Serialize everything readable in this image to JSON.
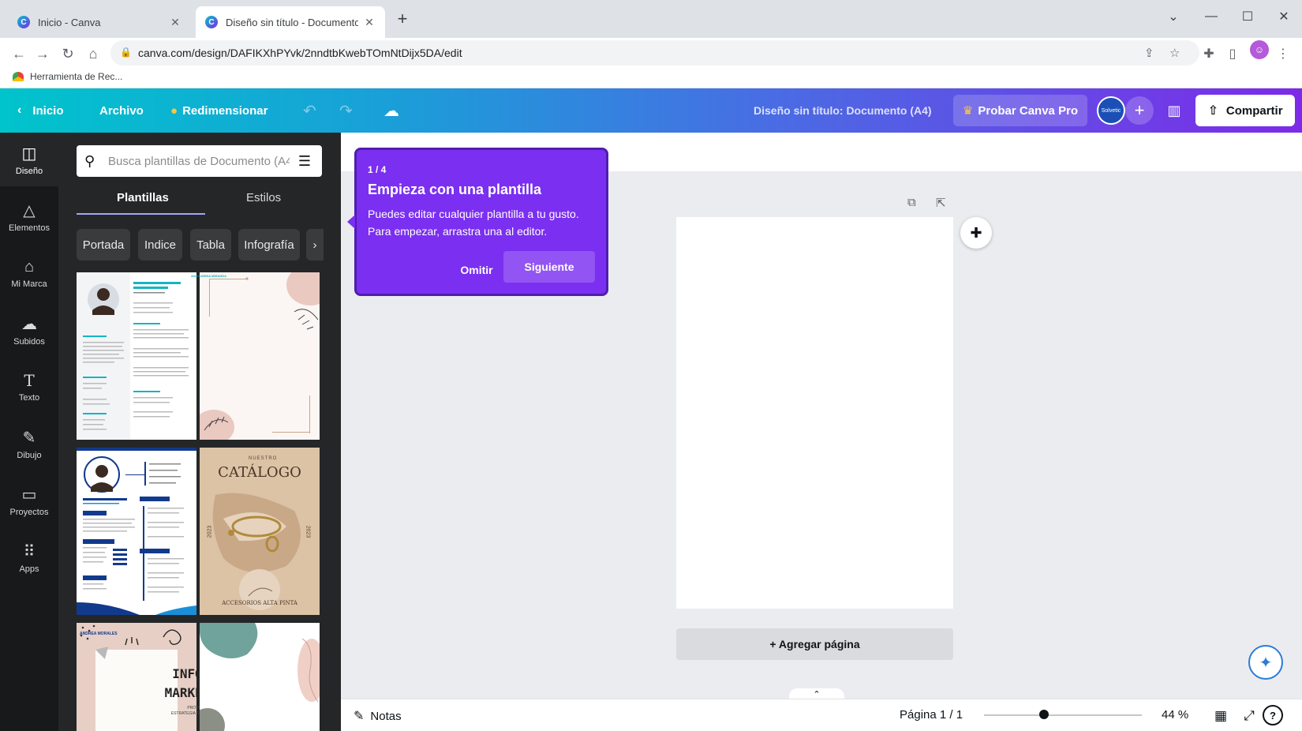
{
  "browser": {
    "tabs": [
      {
        "title": "Inicio - Canva"
      },
      {
        "title": "Diseño sin título - Documento (A"
      }
    ],
    "url": "canva.com/design/DAFIKXhPYvk/2nndtbKwebTOmNtDijx5DA/edit",
    "bookmark": "Herramienta de Rec..."
  },
  "header": {
    "home": "Inicio",
    "file": "Archivo",
    "resize": "Redimensionar",
    "doc_title": "Diseño sin título: Documento (A4)",
    "try_pro": "Probar Canva Pro",
    "share": "Compartir",
    "team_label": "Solvetic"
  },
  "rail": {
    "items": [
      {
        "label": "Diseño"
      },
      {
        "label": "Elementos"
      },
      {
        "label": "Mi Marca"
      },
      {
        "label": "Subidos"
      },
      {
        "label": "Texto"
      },
      {
        "label": "Dibujo"
      },
      {
        "label": "Proyectos"
      },
      {
        "label": "Apps"
      }
    ]
  },
  "panel": {
    "search_placeholder": "Busca plantillas de Documento (A4",
    "tabs": [
      "Plantillas",
      "Estilos"
    ],
    "chips": [
      "Portada",
      "Indice",
      "Tabla",
      "Infografía"
    ],
    "templates": {
      "cv1": {
        "name": "ANA KARINA MIRANDA",
        "role": "Diseñadora Gráfica",
        "left_heads": [
          "PERFIL",
          "EDUCACIÓN",
          "HABILIDADES"
        ],
        "right_heads": [
          "EXPERIENCIA",
          "REFERENCIAS"
        ]
      },
      "cv2": {
        "name": "ANDREA MORALES",
        "role": "Community Manager",
        "left_heads": [
          "PERFIL",
          "HABILIDADES",
          "IDIOMAS"
        ],
        "right_heads": [
          "EDUCACIÓN",
          "EXPERIENCIA"
        ]
      },
      "catalog": {
        "small": "NUESTRO",
        "title": "CATÁLOGO",
        "year": "2023",
        "footer": "ACCESORIOS ALTA PINTA"
      },
      "report": {
        "line1": "INFORME",
        "line2": "MARKETING",
        "sub1": "PROYECTO:",
        "sub2": "ESTRATEGIA DE MARKETING"
      }
    }
  },
  "tooltip": {
    "step": "1 / 4",
    "title": "Empieza con una plantilla",
    "body": "Puedes editar cualquier plantilla a tu gusto. Para empezar, arrastra una al editor.",
    "skip": "Omitir",
    "next": "Siguiente"
  },
  "canvas": {
    "add_page": "+ Agregar página"
  },
  "bottom": {
    "notes": "Notas",
    "page_count": "Página 1 / 1",
    "zoom": "44 %",
    "zoom_level": 0.38
  },
  "colors": {
    "brand_gradient_start": "#00c4cc",
    "brand_gradient_end": "#7d2ae8",
    "tooltip": "#7b2ff0"
  }
}
